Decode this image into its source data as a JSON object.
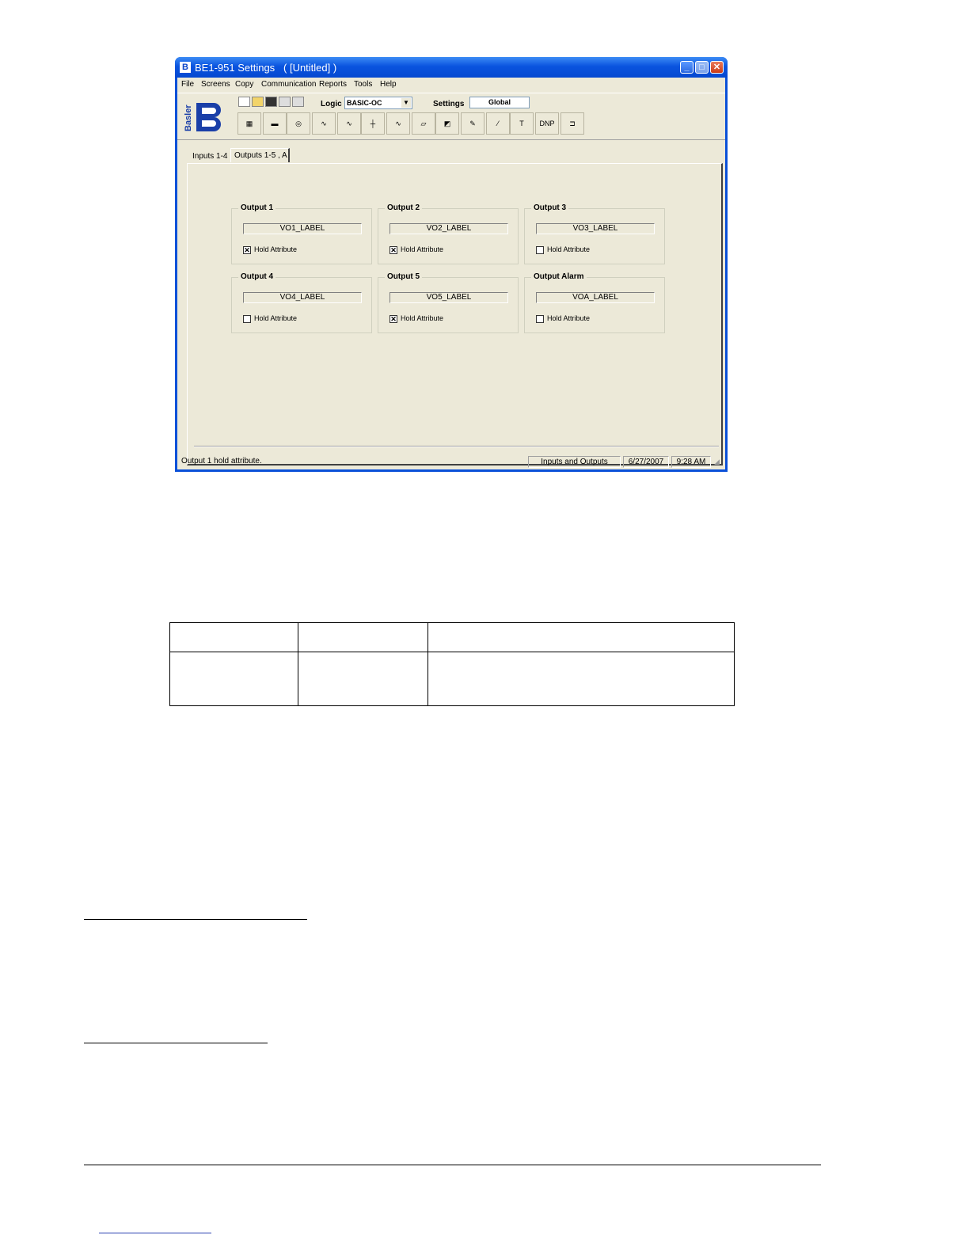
{
  "window": {
    "title": "BE1-951 Settings   ( [Untitled] )",
    "controls": {
      "minimize": "_",
      "maximize": "□",
      "close": "✕"
    }
  },
  "menu": [
    "File",
    "Screens",
    "Copy",
    "Communication",
    "Reports",
    "Tools",
    "Help"
  ],
  "toolbar": {
    "logo_text": "Basler",
    "logic_label": "Logic",
    "logic_value": "BASIC-OC",
    "settings_label": "Settings",
    "settings_value": "Global",
    "dnp_label": "DNP"
  },
  "tabs": [
    "Inputs 1-4",
    "Outputs 1-5 , A"
  ],
  "outputs": [
    {
      "title": "Output 1",
      "label": "VO1_LABEL",
      "checkbox": "Hold Attribute",
      "checked": true
    },
    {
      "title": "Output 2",
      "label": "VO2_LABEL",
      "checkbox": "Hold Attribute",
      "checked": true
    },
    {
      "title": "Output 3",
      "label": "VO3_LABEL",
      "checkbox": "Hold Attribute",
      "checked": false
    },
    {
      "title": "Output 4",
      "label": "VO4_LABEL",
      "checkbox": "Hold Attribute",
      "checked": false
    },
    {
      "title": "Output 5",
      "label": "VO5_LABEL",
      "checkbox": "Hold Attribute",
      "checked": true
    },
    {
      "title": "Output Alarm",
      "label": "VOA_LABEL",
      "checkbox": "Hold Attribute",
      "checked": false
    }
  ],
  "status": {
    "message": "Output 1 hold attribute.",
    "screen": "Inputs and Outputs",
    "date": "6/27/2007",
    "time": "9:28 AM"
  },
  "colors": {
    "titlebar": "#0a54df",
    "client": "#ece9d8"
  }
}
